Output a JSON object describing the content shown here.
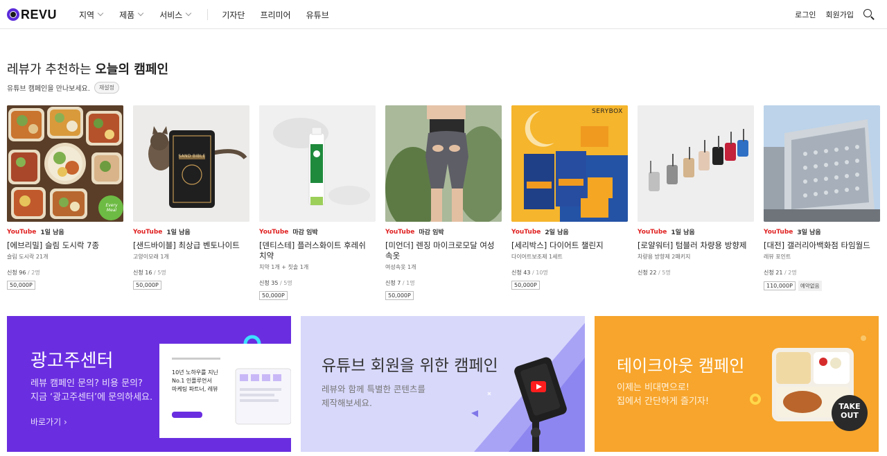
{
  "header": {
    "logo_text": "REVU",
    "nav": [
      {
        "label": "지역",
        "dropdown": true
      },
      {
        "label": "제품",
        "dropdown": true
      },
      {
        "label": "서비스",
        "dropdown": true
      },
      {
        "label": "기자단",
        "dropdown": false
      },
      {
        "label": "프리미어",
        "dropdown": false
      },
      {
        "label": "유튜브",
        "dropdown": false
      }
    ],
    "login": "로그인",
    "signup": "회원가입"
  },
  "section": {
    "title_plain": "레뷰가 추천하는 ",
    "title_bold": "오늘의 캠페인",
    "subtitle": "유튜브 캠페인을 만나보세요.",
    "reset_label": "재설정"
  },
  "campaigns": [
    {
      "platform": "YouTube",
      "deadline": "1일 남음",
      "title": "[에브리밀] 슬림 도시락 7종",
      "desc": "슬림 도시락 21개",
      "applied": "신청 96",
      "max": "/ 2명",
      "points": "50,000P",
      "extra": ""
    },
    {
      "platform": "YouTube",
      "deadline": "1일 남음",
      "title": "[샌드바이블] 최상급 벤토나이트",
      "desc": "고양이모래 1개",
      "applied": "신청 16",
      "max": "/ 5명",
      "points": "50,000P",
      "extra": ""
    },
    {
      "platform": "YouTube",
      "deadline": "마감 임박",
      "title": "[덴티스테] 플러스화이트 후레쉬 치약",
      "desc": "치약 1개 + 칫솔 1개",
      "applied": "신청 35",
      "max": "/ 5명",
      "points": "50,000P",
      "extra": ""
    },
    {
      "platform": "YouTube",
      "deadline": "마감 임박",
      "title": "[미언더] 렌징 마이크로모달 여성속옷",
      "desc": "여성속옷 1개",
      "applied": "신청 7",
      "max": "/ 1명",
      "points": "50,000P",
      "extra": ""
    },
    {
      "platform": "YouTube",
      "deadline": "2일 남음",
      "title": "[세리박스] 다이어트 챌린지",
      "desc": "다이어트보조제 1세트",
      "applied": "신청 43",
      "max": "/ 10명",
      "points": "50,000P",
      "extra": ""
    },
    {
      "platform": "YouTube",
      "deadline": "1일 남음",
      "title": "[로얄워터] 텀블러 차량용 방향제",
      "desc": "차량용 방향제 2패키지",
      "applied": "신청 22",
      "max": "/ 5명",
      "points": "",
      "extra": ""
    },
    {
      "platform": "YouTube",
      "deadline": "3일 남음",
      "title": "[대전] 갤러리아백화점 타임월드",
      "desc": "레뷰 포인트",
      "applied": "신청 21",
      "max": "/ 2명",
      "points": "110,000P",
      "extra": "예약없음"
    }
  ],
  "banners": {
    "ad_center": {
      "title": "광고주센터",
      "desc_line1": "레뷰 캠페인 문의? 비용 문의?",
      "desc_line2": "지금 ‘광고주센터’에 문의하세요.",
      "link": "바로가기 ›",
      "mock_line1": "10년 노하우를 지닌",
      "mock_line2": "No.1 인플루언서",
      "mock_line3": "마케팅 파트너, 레뷰"
    },
    "youtube": {
      "title": "유튜브 회원을 위한 캠페인",
      "desc_line1": "레뷰와 함께 특별한 콘텐츠를",
      "desc_line2": "제작해보세요."
    },
    "takeout": {
      "title": "테이크아웃 캠페인",
      "desc_line1": "이제는 비대면으로!",
      "desc_line2": "집에서 간단하게 즐기자!",
      "badge_line1": "TAKE",
      "badge_line2": "OUT"
    }
  },
  "thumb_labels": {
    "everymeal": "Every Meal",
    "sandbible": "SAND BIBLE",
    "serybox": "SERYBOX"
  }
}
